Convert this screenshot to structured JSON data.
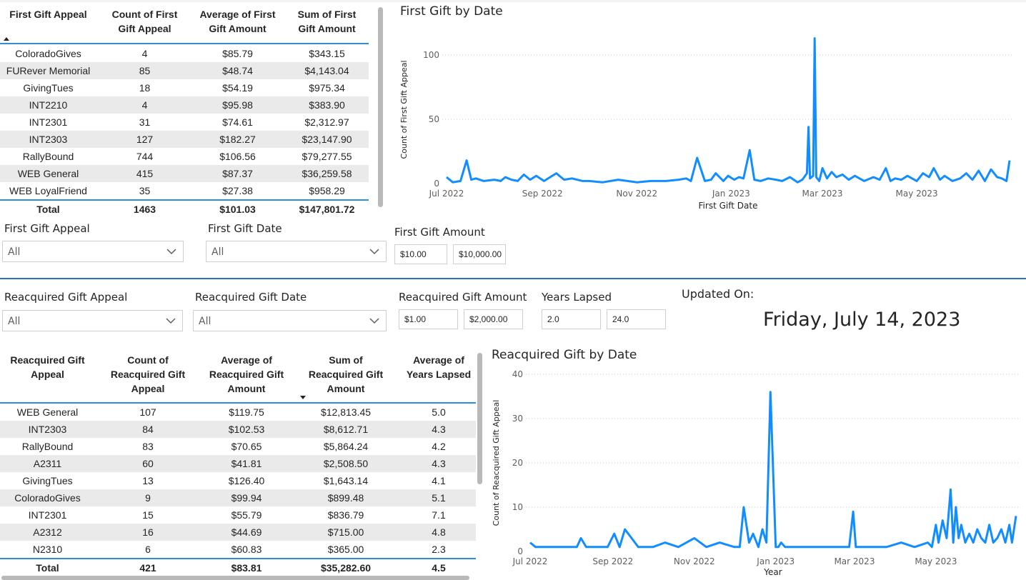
{
  "first_table": {
    "headers": [
      "First Gift Appeal",
      "Count of First Gift Appeal",
      "Average of First Gift Amount",
      "Sum of First Gift Amount"
    ],
    "header_lines": [
      [
        "First Gift Appeal"
      ],
      [
        "Count of First",
        "Gift Appeal"
      ],
      [
        "Average of First",
        "Gift Amount"
      ],
      [
        "Sum of First",
        "Gift Amount"
      ]
    ],
    "rows": [
      [
        "ColoradoGives",
        "4",
        "$85.79",
        "$343.15"
      ],
      [
        "FURever Memorial",
        "85",
        "$48.74",
        "$4,143.04"
      ],
      [
        "GivingTues",
        "18",
        "$54.19",
        "$975.34"
      ],
      [
        "INT2210",
        "4",
        "$95.98",
        "$383.90"
      ],
      [
        "INT2301",
        "31",
        "$74.61",
        "$2,312.97"
      ],
      [
        "INT2303",
        "127",
        "$182.27",
        "$23,147.90"
      ],
      [
        "RallyBound",
        "744",
        "$106.56",
        "$79,277.55"
      ],
      [
        "WEB General",
        "415",
        "$87.37",
        "$36,259.58"
      ],
      [
        "WEB LoyalFriend",
        "35",
        "$27.38",
        "$958.29"
      ]
    ],
    "total": [
      "Total",
      "1463",
      "$101.03",
      "$147,801.72"
    ]
  },
  "first_slicers": {
    "appeal": {
      "label": "First Gift Appeal",
      "value": "All"
    },
    "date": {
      "label": "First Gift Date",
      "value": "All"
    },
    "amount": {
      "label": "First Gift Amount",
      "min": "$10.00",
      "max": "$10,000.00"
    }
  },
  "reacq_slicers": {
    "appeal": {
      "label": "Reacquired Gift Appeal",
      "value": "All"
    },
    "date": {
      "label": "Reacquired Gift Date",
      "value": "All"
    },
    "amount": {
      "label": "Reacquired Gift Amount",
      "min": "$1.00",
      "max": "$2,000.00"
    },
    "years": {
      "label": "Years Lapsed",
      "min": "2.0",
      "max": "24.0"
    }
  },
  "updated": {
    "label": "Updated On:",
    "date": "Friday, July 14, 2023"
  },
  "reacq_table": {
    "headers": [
      "Reacquired Gift Appeal",
      "Count of Reacquired Gift Appeal",
      "Average of Reacquired Gift Amount",
      "Sum of Reacquired Gift Amount",
      "Average of Years Lapsed"
    ],
    "header_lines": [
      [
        "Reacquired Gift",
        "Appeal"
      ],
      [
        "Count of",
        "Reacquired Gift",
        "Appeal"
      ],
      [
        "Average of",
        "Reacquired Gift",
        "Amount"
      ],
      [
        "Sum of",
        "Reacquired Gift",
        "Amount"
      ],
      [
        "Average of",
        "Years Lapsed"
      ]
    ],
    "rows": [
      [
        "WEB General",
        "107",
        "$119.75",
        "$12,813.45",
        "5.0"
      ],
      [
        "INT2303",
        "84",
        "$102.53",
        "$8,612.71",
        "4.3"
      ],
      [
        "RallyBound",
        "83",
        "$70.65",
        "$5,864.24",
        "4.2"
      ],
      [
        "A2311",
        "60",
        "$41.81",
        "$2,508.50",
        "4.3"
      ],
      [
        "GivingTues",
        "13",
        "$126.40",
        "$1,643.14",
        "4.1"
      ],
      [
        "ColoradoGives",
        "9",
        "$99.94",
        "$899.48",
        "5.1"
      ],
      [
        "INT2301",
        "15",
        "$55.79",
        "$836.79",
        "7.1"
      ],
      [
        "A2312",
        "16",
        "$44.69",
        "$715.00",
        "4.8"
      ],
      [
        "N2310",
        "6",
        "$60.83",
        "$365.00",
        "2.3"
      ]
    ],
    "total": [
      "Total",
      "421",
      "$83.81",
      "$35,282.60",
      "4.5"
    ]
  },
  "chart_data": [
    {
      "type": "line",
      "title": "First Gift by Date",
      "xlabel": "First Gift Date",
      "ylabel": "Count of First Gift Appeal",
      "x_ticks": [
        "Jul 2022",
        "Sep 2022",
        "Nov 2022",
        "Jan 2023",
        "Mar 2023",
        "May 2023"
      ],
      "y_ticks": [
        0,
        50,
        100
      ],
      "ylim": [
        0,
        115
      ],
      "xlim": [
        "2022-07-01",
        "2023-06-30"
      ],
      "grid": true,
      "color": "#118dff",
      "series": [
        {
          "x": [
            "2022-07-01",
            "2022-07-05",
            "2022-07-10",
            "2022-07-14",
            "2022-07-17",
            "2022-07-20",
            "2022-07-25",
            "2022-08-01",
            "2022-08-05",
            "2022-08-08",
            "2022-08-12",
            "2022-08-16",
            "2022-08-20",
            "2022-08-24",
            "2022-08-28",
            "2022-09-02",
            "2022-09-06",
            "2022-09-10",
            "2022-09-15",
            "2022-09-20",
            "2022-09-27",
            "2022-10-01",
            "2022-10-10",
            "2022-10-20",
            "2022-11-01",
            "2022-11-10",
            "2022-11-20",
            "2022-11-28",
            "2022-12-03",
            "2022-12-06",
            "2022-12-10",
            "2022-12-15",
            "2022-12-19",
            "2022-12-22",
            "2022-12-27",
            "2022-12-30",
            "2023-01-03",
            "2023-01-06",
            "2023-01-09",
            "2023-01-13",
            "2023-01-16",
            "2023-01-20",
            "2023-01-25",
            "2023-01-30",
            "2023-02-03",
            "2023-02-08",
            "2023-02-13",
            "2023-02-16",
            "2023-02-19",
            "2023-02-20",
            "2023-02-21",
            "2023-02-23",
            "2023-02-24",
            "2023-02-25",
            "2023-02-27",
            "2023-03-01",
            "2023-03-04",
            "2023-03-07",
            "2023-03-10",
            "2023-03-14",
            "2023-03-18",
            "2023-03-22",
            "2023-03-28",
            "2023-04-03",
            "2023-04-07",
            "2023-04-11",
            "2023-04-14",
            "2023-04-17",
            "2023-04-21",
            "2023-04-25",
            "2023-05-01",
            "2023-05-05",
            "2023-05-09",
            "2023-05-12",
            "2023-05-16",
            "2023-05-19",
            "2023-05-24",
            "2023-05-29",
            "2023-06-02",
            "2023-06-06",
            "2023-06-10",
            "2023-06-14",
            "2023-06-18",
            "2023-06-22",
            "2023-06-25",
            "2023-06-28",
            "2023-06-30"
          ],
          "y": [
            5,
            1,
            2,
            18,
            3,
            4,
            2,
            3,
            2,
            5,
            3,
            2,
            7,
            3,
            6,
            2,
            5,
            8,
            3,
            4,
            2,
            2,
            1,
            3,
            1,
            2,
            2,
            3,
            4,
            2,
            20,
            2,
            3,
            8,
            2,
            6,
            3,
            5,
            4,
            26,
            3,
            2,
            4,
            3,
            2,
            5,
            1,
            3,
            8,
            44,
            4,
            6,
            113,
            5,
            2,
            12,
            4,
            9,
            5,
            7,
            3,
            6,
            2,
            5,
            3,
            12,
            2,
            4,
            3,
            6,
            2,
            8,
            5,
            12,
            3,
            6,
            2,
            4,
            8,
            3,
            10,
            2,
            11,
            5,
            4,
            2,
            18
          ]
        }
      ]
    },
    {
      "type": "line",
      "title": "Reacquired Gift by Date",
      "xlabel": "Year",
      "ylabel": "Count of Reacquired Gift Appeal",
      "x_ticks": [
        "Jul 2022",
        "Sep 2022",
        "Nov 2022",
        "Jan 2023",
        "Mar 2023",
        "May 2023"
      ],
      "y_ticks": [
        0,
        10,
        20,
        30,
        40
      ],
      "ylim": [
        0,
        40
      ],
      "xlim": [
        "2022-07-01",
        "2023-06-30"
      ],
      "grid": true,
      "color": "#118dff",
      "series": [
        {
          "x": [
            "2022-07-01",
            "2022-07-05",
            "2022-07-15",
            "2022-07-25",
            "2022-08-05",
            "2022-08-08",
            "2022-08-12",
            "2022-08-20",
            "2022-08-28",
            "2022-09-02",
            "2022-09-06",
            "2022-09-10",
            "2022-09-20",
            "2022-10-01",
            "2022-10-10",
            "2022-10-20",
            "2022-11-01",
            "2022-11-10",
            "2022-11-20",
            "2022-12-01",
            "2022-12-05",
            "2022-12-08",
            "2022-12-12",
            "2022-12-15",
            "2022-12-19",
            "2022-12-22",
            "2022-12-25",
            "2022-12-28",
            "2023-01-01",
            "2023-01-03",
            "2023-01-05",
            "2023-01-08",
            "2023-01-15",
            "2023-01-25",
            "2023-02-05",
            "2023-02-15",
            "2023-02-25",
            "2023-02-28",
            "2023-03-02",
            "2023-03-06",
            "2023-03-15",
            "2023-03-25",
            "2023-04-05",
            "2023-04-15",
            "2023-04-25",
            "2023-04-28",
            "2023-05-01",
            "2023-05-03",
            "2023-05-06",
            "2023-05-09",
            "2023-05-12",
            "2023-05-14",
            "2023-05-16",
            "2023-05-18",
            "2023-05-20",
            "2023-05-23",
            "2023-05-26",
            "2023-05-29",
            "2023-06-01",
            "2023-06-04",
            "2023-06-07",
            "2023-06-10",
            "2023-06-13",
            "2023-06-16",
            "2023-06-19",
            "2023-06-22",
            "2023-06-25",
            "2023-06-27",
            "2023-06-30"
          ],
          "y": [
            2,
            1,
            1,
            1,
            1,
            3,
            1,
            1,
            1,
            4,
            1,
            5,
            1,
            1,
            2,
            1,
            3,
            1,
            2,
            1,
            1,
            10,
            2,
            4,
            1,
            5,
            2,
            36,
            1,
            1,
            2,
            1,
            1,
            1,
            1,
            1,
            1,
            9,
            1,
            1,
            1,
            1,
            2,
            1,
            2,
            1,
            6,
            2,
            7,
            3,
            14,
            2,
            10,
            3,
            6,
            2,
            4,
            2,
            5,
            3,
            2,
            6,
            2,
            3,
            5,
            2,
            6,
            2,
            8
          ]
        }
      ]
    }
  ]
}
